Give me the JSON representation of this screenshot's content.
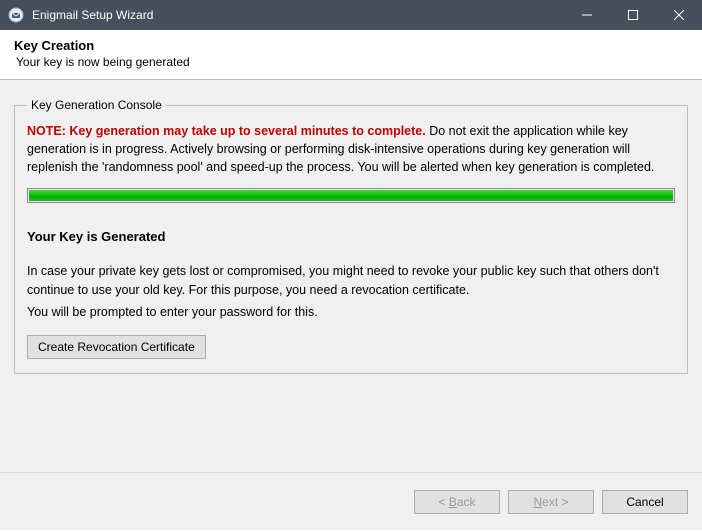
{
  "window": {
    "title": "Enigmail Setup Wizard"
  },
  "header": {
    "title": "Key Creation",
    "subtitle": "Your key is now being generated"
  },
  "console": {
    "legend": "Key Generation Console",
    "note_label": "NOTE: Key generation may take up to several minutes to complete.",
    "note_body": " Do not exit the application while key generation is in progress. Actively browsing or performing disk-intensive operations during key generation will replenish the 'randomness pool' and speed-up the process. You will be alerted when key generation is completed.",
    "progress_percent": 100,
    "generated_heading": "Your Key is Generated",
    "revoke_para1": "In case your private key gets lost or compromised, you might need to revoke your public key such that others don't continue to use your old key. For this purpose, you need a revocation certificate.",
    "revoke_para2": "You will be prompted to enter your password for this.",
    "cert_button": "Create Revocation Certificate"
  },
  "footer": {
    "back_full": "< Back",
    "next_full": "Next >",
    "cancel": "Cancel"
  }
}
